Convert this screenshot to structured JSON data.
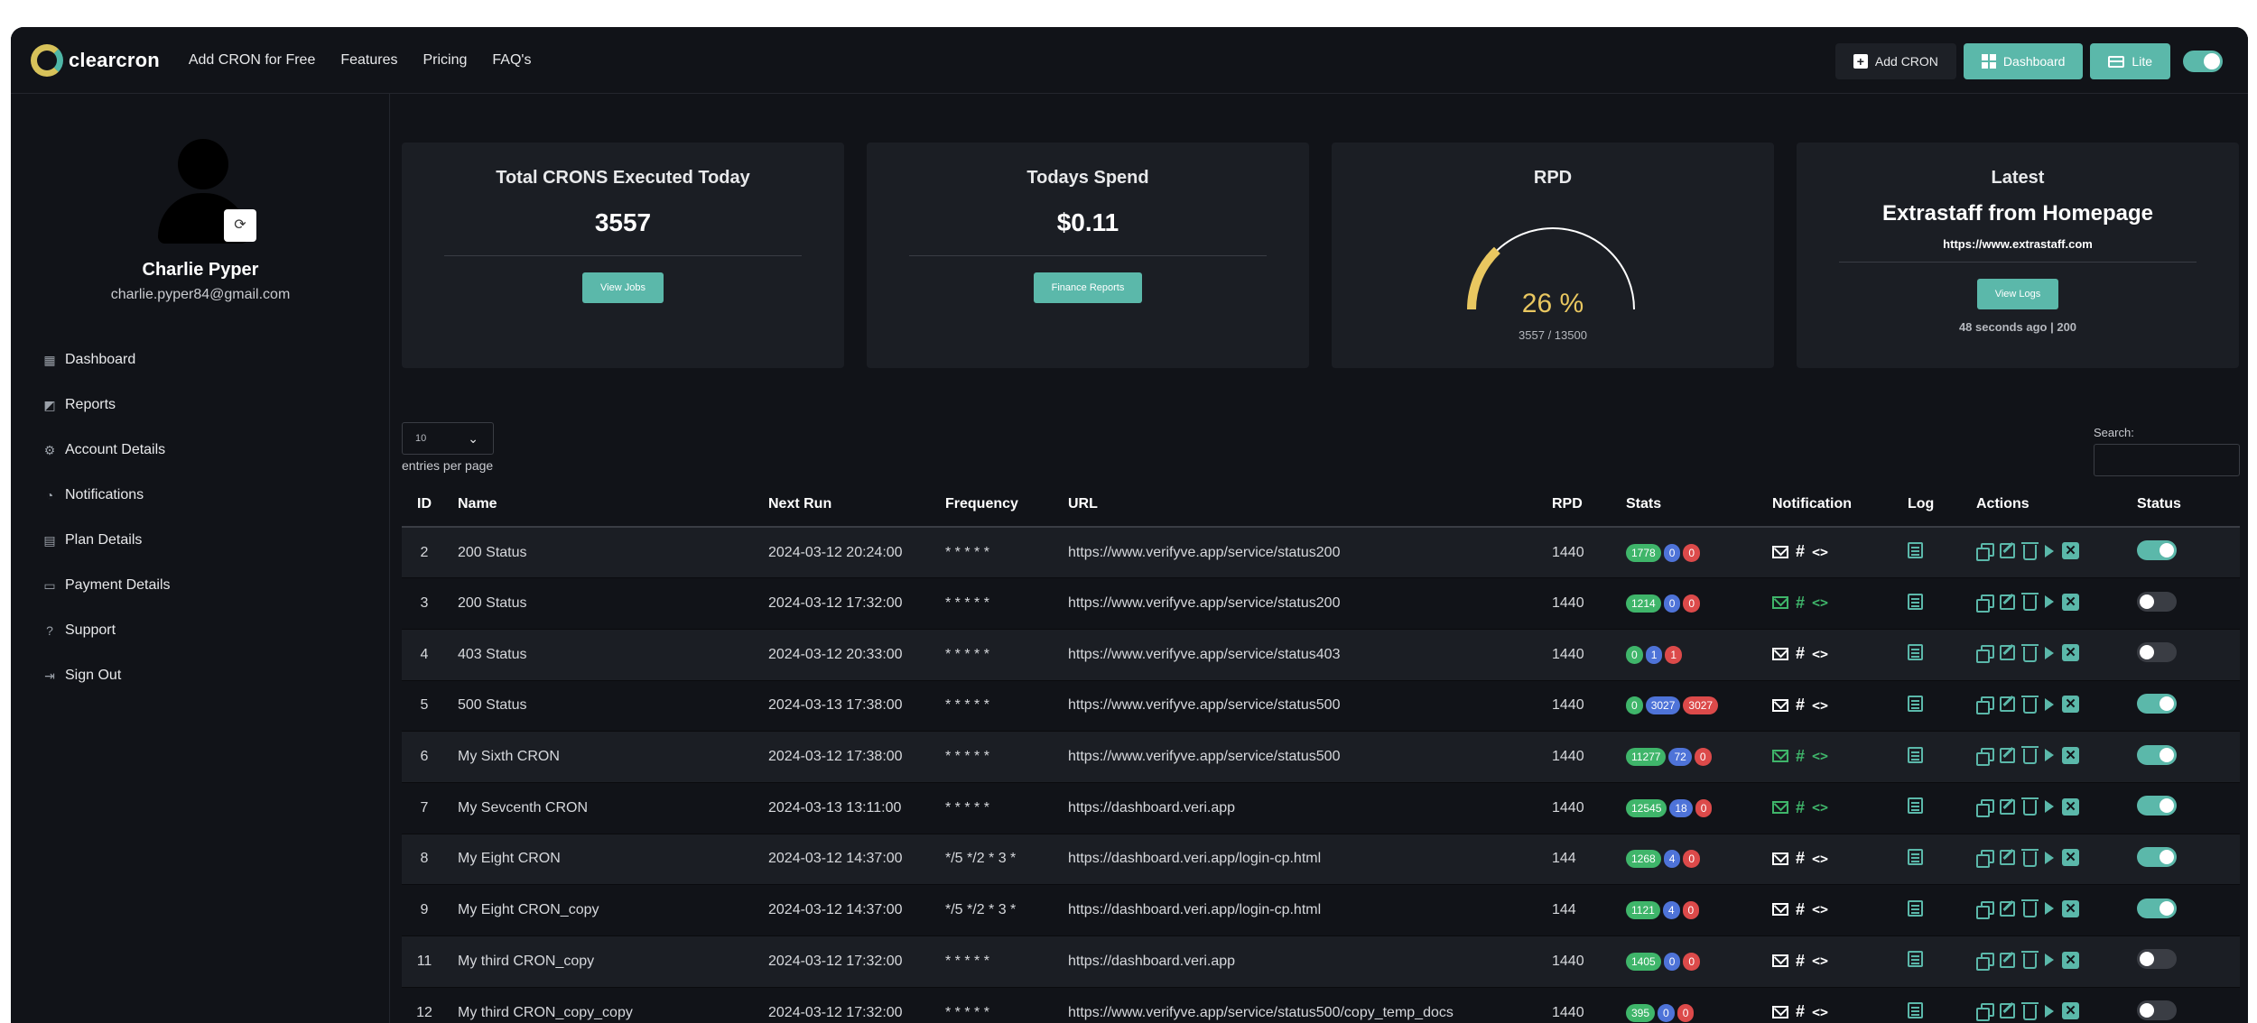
{
  "brand": {
    "name": "clearcron"
  },
  "nav": [
    "Add CRON for Free",
    "Features",
    "Pricing",
    "FAQ's"
  ],
  "top_actions": {
    "add": "Add CRON",
    "dashboard": "Dashboard",
    "lite": "Lite"
  },
  "user": {
    "name": "Charlie Pyper",
    "email": "charlie.pyper84@gmail.com"
  },
  "sidebar": [
    {
      "label": "Dashboard",
      "icon": "dashboard-icon"
    },
    {
      "label": "Reports",
      "icon": "chart-icon"
    },
    {
      "label": "Account Details",
      "icon": "gear-icon"
    },
    {
      "label": "Notifications",
      "icon": "bell-icon"
    },
    {
      "label": "Plan Details",
      "icon": "document-icon"
    },
    {
      "label": "Payment Details",
      "icon": "card-icon"
    },
    {
      "label": "Support",
      "icon": "help-icon"
    },
    {
      "label": "Sign Out",
      "icon": "sign-out-icon"
    }
  ],
  "cards": {
    "total": {
      "title": "Total CRONS Executed Today",
      "value": "3557",
      "button": "View Jobs"
    },
    "spend": {
      "title": "Todays Spend",
      "value": "$0.11",
      "button": "Finance Reports"
    },
    "rpd": {
      "title": "RPD",
      "percent_text": "26 %",
      "sub": "3557 / 13500",
      "fraction": 0.26
    },
    "latest": {
      "title": "Latest",
      "name": "Extrastaff from Homepage",
      "url": "https://www.extrastaff.com",
      "button": "View Logs",
      "meta": "48 seconds ago | 200"
    }
  },
  "table_controls": {
    "length_value": "10",
    "length_label": "entries per page",
    "search_label": "Search:",
    "search_value": ""
  },
  "columns": [
    "ID",
    "Name",
    "Next Run",
    "Frequency",
    "URL",
    "RPD",
    "Stats",
    "Notification",
    "Log",
    "Actions",
    "Status"
  ],
  "rows": [
    {
      "id": "2",
      "name": "200 Status",
      "next_run": "2024-03-12 20:24:00",
      "frequency": "* * * * *",
      "url": "https://www.verifyve.app/service/status200",
      "rpd": "1440",
      "stats": [
        "1778",
        "0",
        "0"
      ],
      "notif_color": "white",
      "status": "on"
    },
    {
      "id": "3",
      "name": "200 Status",
      "next_run": "2024-03-12 17:32:00",
      "frequency": "* * * * *",
      "url": "https://www.verifyve.app/service/status200",
      "rpd": "1440",
      "stats": [
        "1214",
        "0",
        "0"
      ],
      "notif_color": "green",
      "status": "off"
    },
    {
      "id": "4",
      "name": "403 Status",
      "next_run": "2024-03-12 20:33:00",
      "frequency": "* * * * *",
      "url": "https://www.verifyve.app/service/status403",
      "rpd": "1440",
      "stats": [
        "0",
        "1",
        "1"
      ],
      "notif_color": "white",
      "status": "off"
    },
    {
      "id": "5",
      "name": "500 Status",
      "next_run": "2024-03-13 17:38:00",
      "frequency": "* * * * *",
      "url": "https://www.verifyve.app/service/status500",
      "rpd": "1440",
      "stats": [
        "0",
        "3027",
        "3027"
      ],
      "notif_color": "white",
      "status": "on"
    },
    {
      "id": "6",
      "name": "My Sixth CRON",
      "next_run": "2024-03-12 17:38:00",
      "frequency": "* * * * *",
      "url": "https://www.verifyve.app/service/status500",
      "rpd": "1440",
      "stats": [
        "11277",
        "72",
        "0"
      ],
      "notif_color": "green",
      "status": "on"
    },
    {
      "id": "7",
      "name": "My Sevcenth CRON",
      "next_run": "2024-03-13 13:11:00",
      "frequency": "* * * * *",
      "url": "https://dashboard.veri.app",
      "rpd": "1440",
      "stats": [
        "12545",
        "18",
        "0"
      ],
      "notif_color": "green",
      "status": "on"
    },
    {
      "id": "8",
      "name": "My Eight CRON",
      "next_run": "2024-03-12 14:37:00",
      "frequency": "*/5 */2 * 3 *",
      "url": "https://dashboard.veri.app/login-cp.html",
      "rpd": "144",
      "stats": [
        "1268",
        "4",
        "0"
      ],
      "notif_color": "white",
      "status": "on"
    },
    {
      "id": "9",
      "name": "My Eight CRON_copy",
      "next_run": "2024-03-12 14:37:00",
      "frequency": "*/5 */2 * 3 *",
      "url": "https://dashboard.veri.app/login-cp.html",
      "rpd": "144",
      "stats": [
        "1121",
        "4",
        "0"
      ],
      "notif_color": "white",
      "status": "on"
    },
    {
      "id": "11",
      "name": "My third CRON_copy",
      "next_run": "2024-03-12 17:32:00",
      "frequency": "* * * * *",
      "url": "https://dashboard.veri.app",
      "rpd": "1440",
      "stats": [
        "1405",
        "0",
        "0"
      ],
      "notif_color": "white",
      "status": "off"
    },
    {
      "id": "12",
      "name": "My third CRON_copy_copy",
      "next_run": "2024-03-12 17:32:00",
      "frequency": "* * * * *",
      "url": "https://www.verifyve.app/service/status500/copy_temp_docs",
      "rpd": "1440",
      "stats": [
        "395",
        "0",
        "0"
      ],
      "notif_color": "white",
      "status": "off"
    }
  ],
  "colors": {
    "accent": "#5bb8aa",
    "gauge": "#e9c760",
    "success": "#3fb56a",
    "info": "#4e73d8",
    "danger": "#dc4a4a"
  }
}
